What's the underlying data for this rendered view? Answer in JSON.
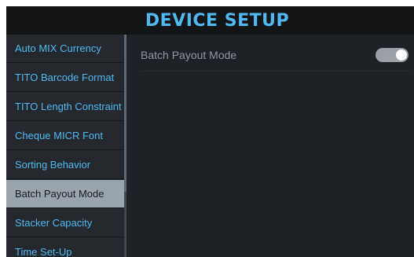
{
  "header": {
    "title": "DEVICE SETUP"
  },
  "sidebar": {
    "selected_index": 5,
    "items": [
      {
        "label": "Auto MIX Currency"
      },
      {
        "label": "TITO Barcode Format"
      },
      {
        "label": "TITO Length Constraint"
      },
      {
        "label": "Cheque MICR Font"
      },
      {
        "label": "Sorting Behavior"
      },
      {
        "label": "Batch Payout Mode"
      },
      {
        "label": "Stacker Capacity"
      },
      {
        "label": "Time Set-Up"
      }
    ]
  },
  "content": {
    "setting_label": "Batch Payout Mode",
    "toggle_on": true
  },
  "colors": {
    "accent": "#4fb8f0",
    "background": "#1e2125",
    "header_background": "#121416",
    "sidebar_background": "#25282c",
    "selected_item_background": "#9aa4ad",
    "label_text": "#8e979f",
    "toggle_track": "#9aa0a6"
  }
}
